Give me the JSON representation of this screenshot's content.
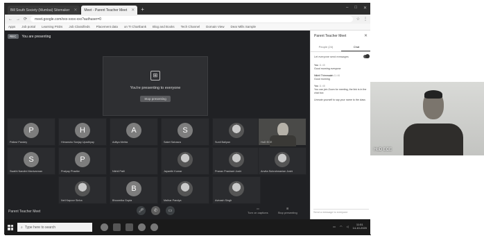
{
  "browser": {
    "tabs": [
      {
        "label": "Bill South Society (Mumbai) Sitemaker"
      },
      {
        "label": "Meet - Parent Teacher Meet",
        "active": true
      }
    ],
    "url": "meet.google.com/xxx-xxxx-xxx?authuser=0",
    "bookmarks": [
      "Apps",
      "Job portal",
      "Learning PSDs",
      "Job Classifieds",
      "Placement data",
      "on TI Chartbank",
      "Blog and Books",
      "Tech Channel",
      "Domain View",
      "Dear Mills Sample"
    ]
  },
  "meet": {
    "badge": "REC",
    "presenting_label": "You are presenting",
    "present_card": {
      "text": "You're presenting to everyone",
      "stop_label": "Stop presenting"
    },
    "participants": [
      {
        "initial": "P",
        "name": "Pallavi Pandey"
      },
      {
        "initial": "H",
        "name": "Himanshu Sanjay Upadhyay"
      },
      {
        "initial": "A",
        "name": "Aditya Mehta"
      },
      {
        "initial": "S",
        "name": "Saket Sahasra"
      },
      {
        "initial": "",
        "name": "Sunil Baliyan"
      },
      {
        "initial": "",
        "name": "HoD ECE"
      },
      {
        "initial": "S",
        "name": "Swathi Nandini Manivannan"
      },
      {
        "initial": "P",
        "name": "Pratyay Phadke"
      },
      {
        "initial": "",
        "name": "Nikhil Patil"
      },
      {
        "initial": "",
        "name": "Jayanthi Kumar"
      },
      {
        "initial": "",
        "name": "Pranav Prashant Joshi"
      },
      {
        "initial": "",
        "name": "Anvita Subrahmanian Joshi"
      },
      {
        "initial": "",
        "name": "Neil Kapoor Sinha"
      },
      {
        "initial": "B",
        "name": "Bhoomika Gupta"
      },
      {
        "initial": "",
        "name": "Malhar Pandya"
      },
      {
        "initial": "",
        "name": "Avinash Singh"
      }
    ],
    "meeting_name": "Parent Teacher Meet",
    "right_controls": [
      "Turn on captions",
      "Stop presenting"
    ]
  },
  "panel": {
    "title": "Parent Teacher Meet",
    "tabs": [
      "People (24)",
      "Chat"
    ],
    "toggle_label": "Let everyone send messages",
    "messages": [
      {
        "who": "You",
        "time": "11:45",
        "text": "Good morning everyone"
      },
      {
        "who": "Nikhil Thimmaiah",
        "time": "11:46",
        "text": "Good morning"
      },
      {
        "who": "You",
        "time": "11:48",
        "text": "You can join Zoom for meeting, the link is in the chat box"
      },
      {
        "who": "",
        "time": "",
        "text": "Unmute yourself to say your name to the class"
      }
    ],
    "input_placeholder": "Send a message to everyone"
  },
  "taskbar": {
    "search_placeholder": "Type here to search",
    "time": "11:51",
    "date": "14-10-2020"
  },
  "webcam": {
    "label": "HoD ECE"
  }
}
